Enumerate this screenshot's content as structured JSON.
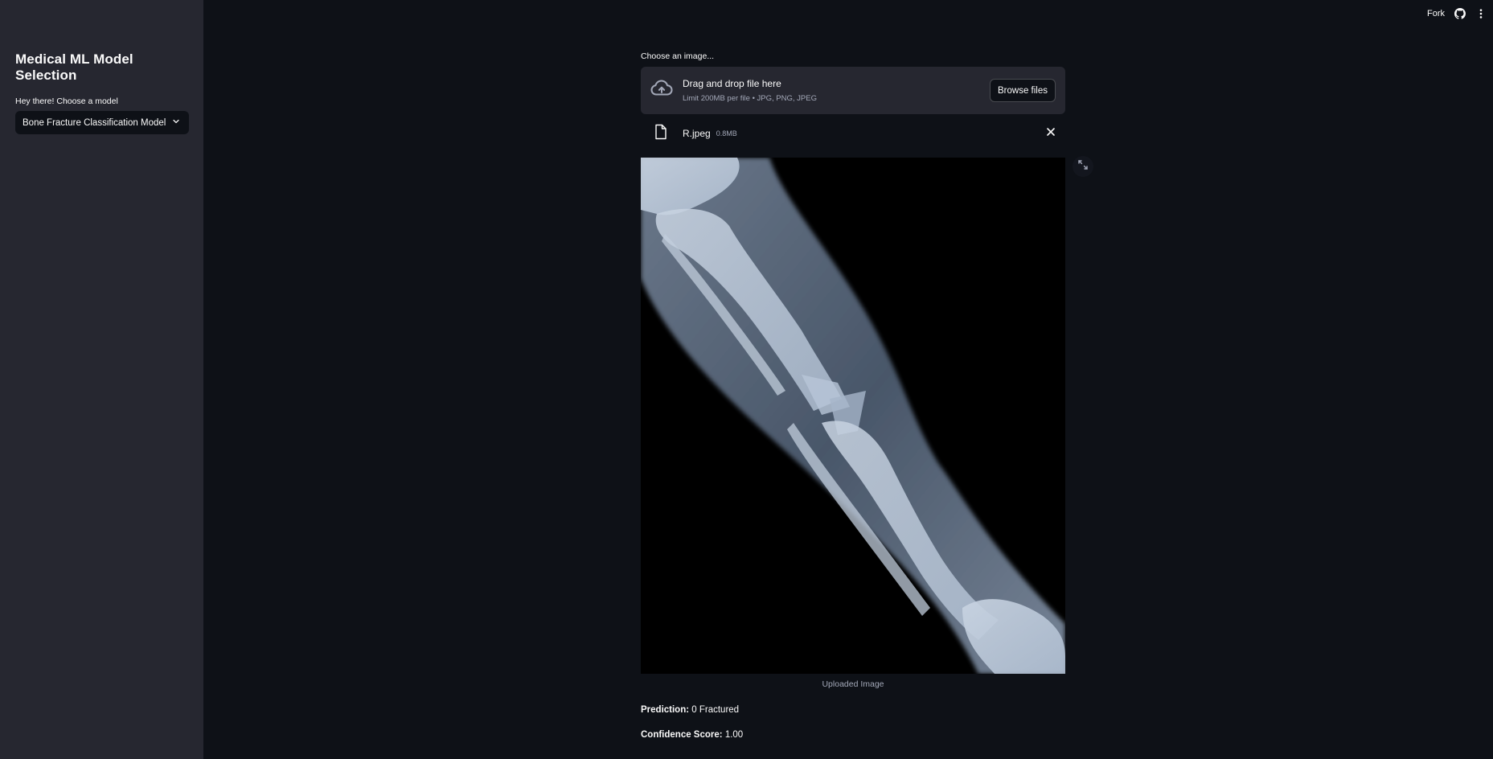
{
  "sidebar": {
    "title": "Medical ML Model Selection",
    "select_label": "Hey there! Choose a model",
    "selected_model": "Bone Fracture Classification Model"
  },
  "topbar": {
    "fork_label": "Fork",
    "icons": [
      "github-icon",
      "more-vert-icon"
    ]
  },
  "uploader": {
    "label": "Choose an image...",
    "drop_text": "Drag and drop file here",
    "limit_text": "Limit 200MB per file • JPG, PNG, JPEG",
    "browse_label": "Browse files",
    "file": {
      "name": "R.jpeg",
      "size": "0.8MB"
    }
  },
  "image": {
    "caption": "Uploaded Image"
  },
  "result": {
    "prediction_label": "Prediction:",
    "prediction_value": "0 Fractured",
    "confidence_label": "Confidence Score:",
    "confidence_value": "1.00"
  },
  "colors": {
    "background": "#0e1117",
    "sidebar": "#262730",
    "text": "#fafafa",
    "muted_text": "#a3a8b8"
  }
}
